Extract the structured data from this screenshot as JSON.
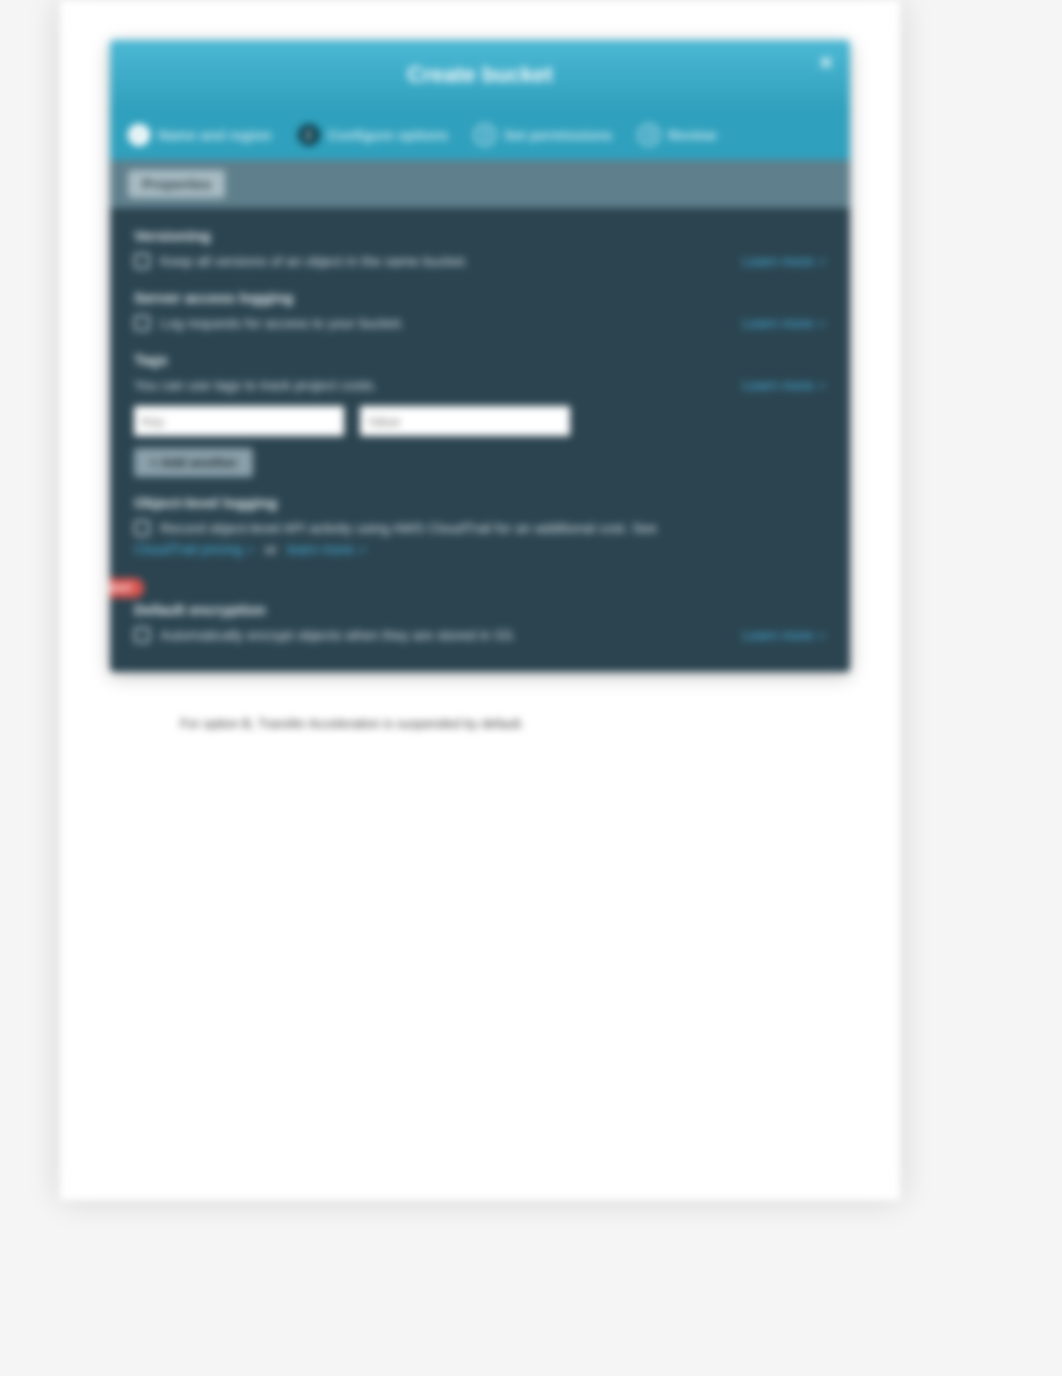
{
  "dialog": {
    "title": "Create bucket",
    "close": "×"
  },
  "steps": {
    "s1": "Name and region",
    "s2": "Configure options",
    "s3": "Set permissions",
    "s4": "Review",
    "n1": "✓",
    "n2": "2",
    "n3": "3",
    "n4": "4"
  },
  "subbar": {
    "tab": "Properties"
  },
  "versioning": {
    "title": "Versioning",
    "desc": "Keep all versions of an object in the same bucket.",
    "link": "Learn more"
  },
  "logging": {
    "title": "Server access logging",
    "desc": "Log requests for access to your bucket.",
    "link": "Learn more"
  },
  "tags": {
    "title": "Tags",
    "desc": "You can use tags to track project costs.",
    "link": "Learn more",
    "key_placeholder": "Key",
    "value_placeholder": "Value",
    "add_btn": "+ Add another"
  },
  "objlog": {
    "title": "Object-level logging",
    "desc": "Record object-level API activity using AWS CloudTrail for an additional cost. See",
    "pricing": "CloudTrail pricing",
    "or": "or",
    "link": "learn more"
  },
  "new_badge": "New!",
  "encryption": {
    "title": "Default encryption",
    "desc": "Automatically encrypt objects when they are stored in S3.",
    "link": "Learn more"
  },
  "note": "For option B, Transfer Acceleration is suspended by default."
}
